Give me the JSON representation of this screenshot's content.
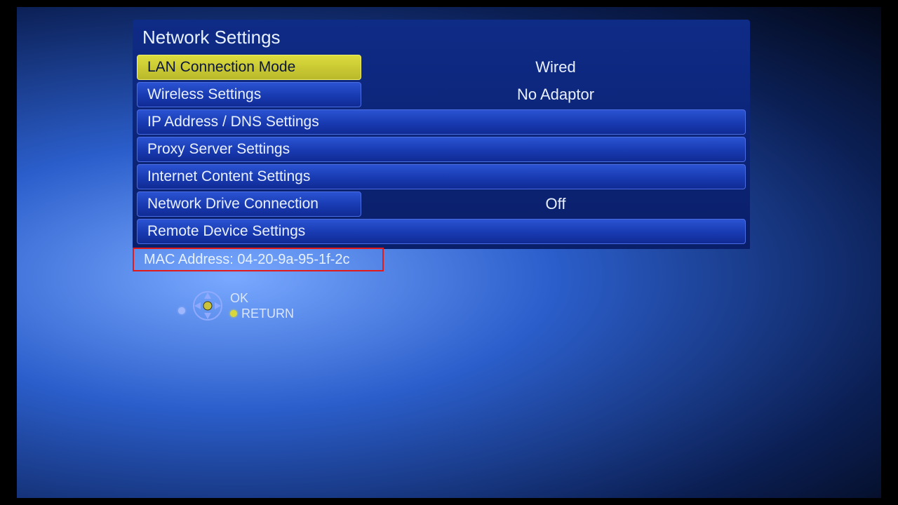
{
  "title": "Network Settings",
  "items": [
    {
      "label": "LAN Connection Mode",
      "value": "Wired",
      "selected": true,
      "full": false
    },
    {
      "label": "Wireless Settings",
      "value": "No Adaptor",
      "selected": false,
      "full": false
    },
    {
      "label": "IP Address / DNS Settings",
      "value": null,
      "selected": false,
      "full": true
    },
    {
      "label": "Proxy Server Settings",
      "value": null,
      "selected": false,
      "full": true
    },
    {
      "label": "Internet Content Settings",
      "value": null,
      "selected": false,
      "full": true
    },
    {
      "label": "Network Drive Connection",
      "value": "Off",
      "selected": false,
      "full": false
    },
    {
      "label": "Remote Device Settings",
      "value": null,
      "selected": false,
      "full": true
    }
  ],
  "mac_label": "MAC Address:",
  "mac_value": "04-20-9a-95-1f-2c",
  "hints": {
    "ok": "OK",
    "return": "RETURN"
  }
}
